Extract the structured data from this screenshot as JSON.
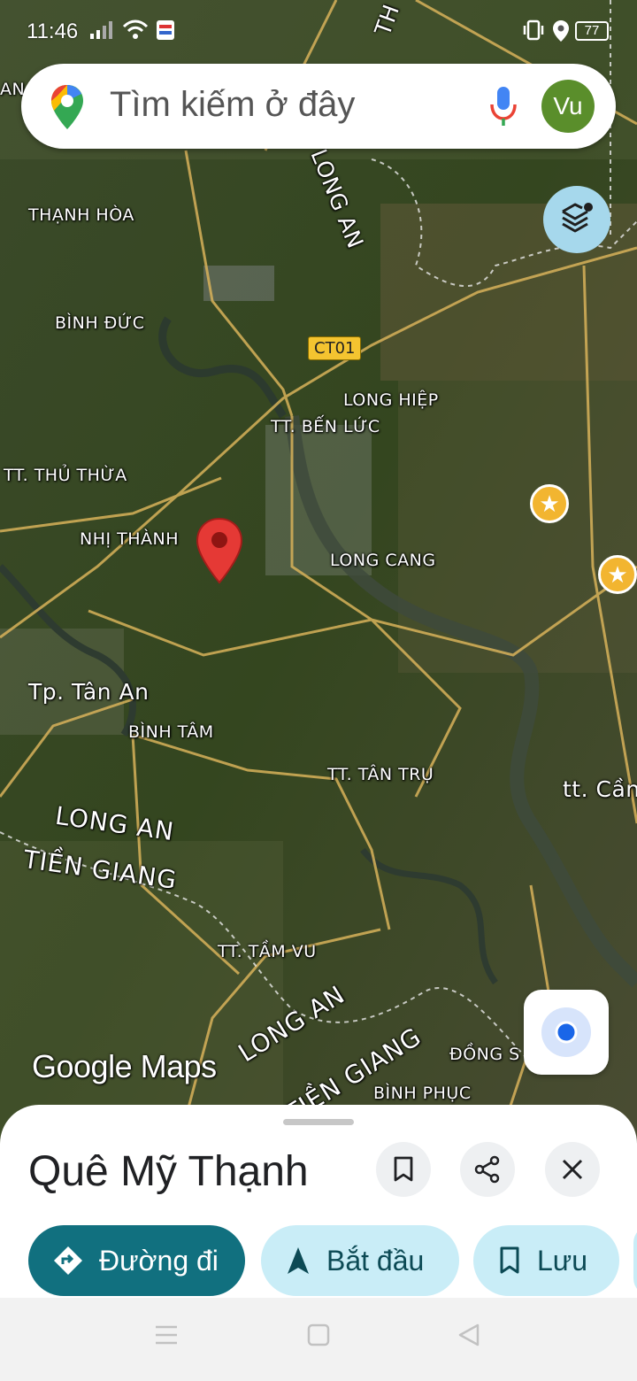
{
  "status_bar": {
    "time": "11:46",
    "battery": "77"
  },
  "search": {
    "placeholder": "Tìm kiếm ở đây",
    "avatar_initials": "Vu"
  },
  "map": {
    "road_shield": "CT01",
    "labels": {
      "thanh_hoa": "THẠNH HÒA",
      "binh_duc": "BÌNH ĐỨC",
      "long_an_top": "LONG AN",
      "long_hiep": "LONG HIỆP",
      "tt_ben_luc": "TT. BẾN LỨC",
      "tt_thu_thua": "TT. THỦ THỪA",
      "nhi_thanh": "NHỊ THÀNH",
      "long_cang": "LONG CANG",
      "tp_tan_an": "Tp. Tân An",
      "binh_tam": "BÌNH TÂM",
      "tt_tan_tru": "TT. TÂN TRỤ",
      "tt_can": "tt. Cần",
      "long_an_left": "LONG AN",
      "tien_giang_left": "TIỀN GIANG",
      "tt_tam_vu": "TT. TẦM VU",
      "long_an_bottom": "LONG AN",
      "tien_giang_bottom": "TIỀN GIANG",
      "dong_s": "ĐỒNG S",
      "binh_phuc": "BÌNH PHỤC",
      "edge_an": "AN",
      "edge_th": "TH"
    },
    "wordmark": "Google Maps"
  },
  "place": {
    "title": "Quê Mỹ Thạnh",
    "directions_label": "Đường đi",
    "start_label": "Bắt đầu",
    "save_label": "Lưu"
  },
  "colors": {
    "directions_chip": "#11707f",
    "action_chip": "#c9edf7",
    "pin": "#e53935",
    "avatar": "#5a8e2b"
  }
}
